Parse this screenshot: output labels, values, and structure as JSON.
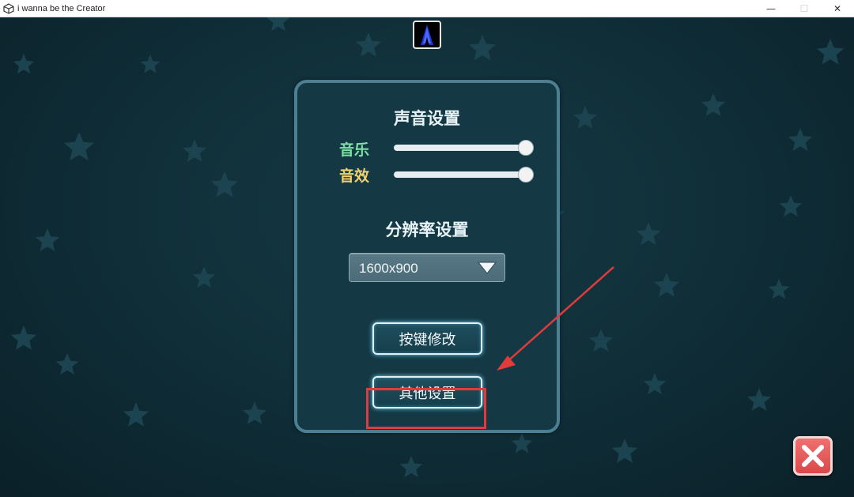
{
  "window": {
    "title": "i wanna be the Creator",
    "minimize_glyph": "—",
    "maximize_glyph": "☐",
    "close_glyph": "✕"
  },
  "settings_panel": {
    "sound_heading": "声音设置",
    "music_label": "音乐",
    "sfx_label": "音效",
    "music_level_percent": 100,
    "sfx_level_percent": 100,
    "resolution_heading": "分辨率设置",
    "resolution_value": "1600x900",
    "key_binding_button": "按键修改",
    "other_settings_button": "其他设置"
  },
  "colors": {
    "music_label": "#7ee0a4",
    "sfx_label": "#f1d272",
    "annotation_red": "#e23b3b",
    "panel_border": "#4c7f92",
    "close_button": "#e05858"
  },
  "icons": {
    "window_icon": "unity-icon",
    "character": "character-portrait-icon",
    "dropdown": "triangle-down-icon",
    "close": "close-x-icon"
  }
}
